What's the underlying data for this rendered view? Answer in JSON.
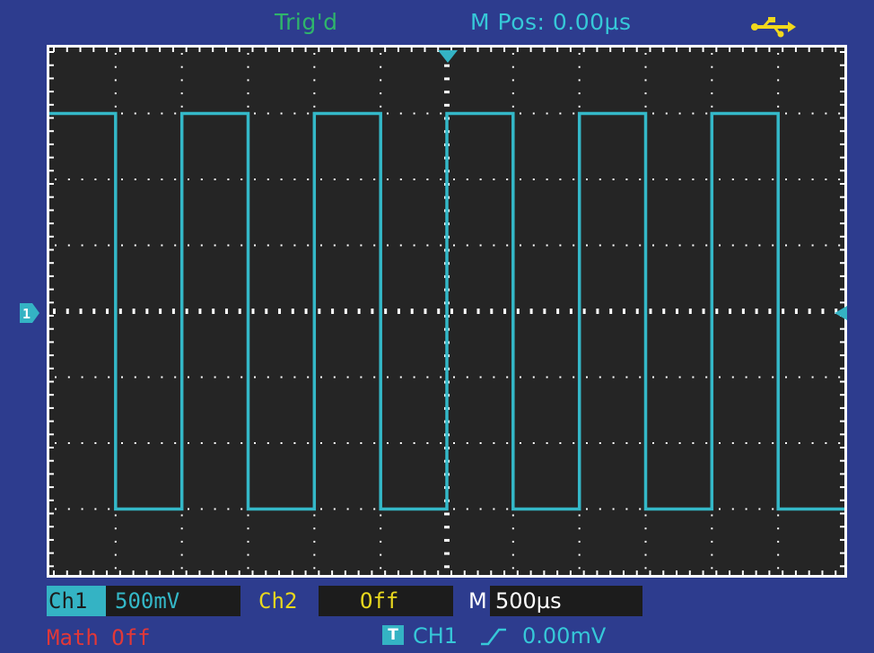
{
  "top_bar": {
    "trigger_status": "Trig'd",
    "horizontal_position": "M Pos: 0.00µs",
    "usb_icon": "usb-icon"
  },
  "display": {
    "channel1_marker": "1",
    "trace_color": "#34b8c8",
    "grid_color": "#ffffff",
    "background_color": "#252525"
  },
  "status_bar": {
    "ch1_label": "Ch1",
    "ch1_scale": "500mV",
    "ch2_label": "Ch2",
    "ch2_state": "Off",
    "timebase_label": "M",
    "timebase_value": "500µs",
    "math_state": "Math Off",
    "trigger_badge": "T",
    "trigger_source": "CH1",
    "trigger_edge_icon": "rising-edge-icon",
    "trigger_level": "0.00mV"
  },
  "colors": {
    "screen_frame": "#2d3c8e",
    "ch1": "#34b3c4",
    "ch2": "#e9d81e",
    "math": "#e23838",
    "trigger_status": "#2fb56b"
  },
  "waveform": {
    "type": "square",
    "channel": "CH1",
    "high_level_div": 3,
    "low_level_div": -3,
    "period_div": 2,
    "horizontal_divisions": 12,
    "vertical_divisions": 8
  }
}
